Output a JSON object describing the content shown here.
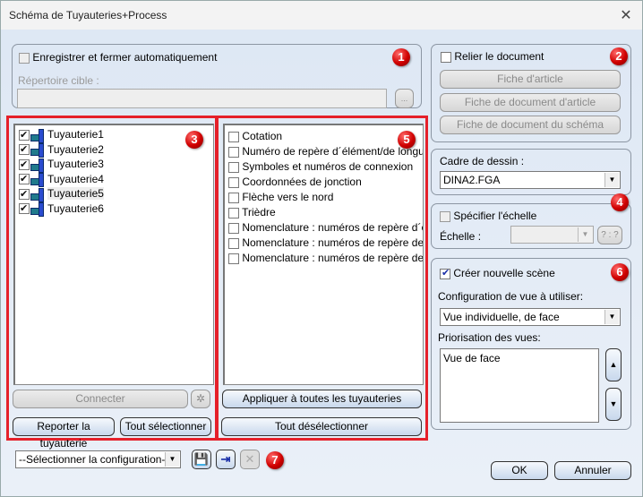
{
  "window": {
    "title": "Schéma de Tuyauteries+Process",
    "close_icon": "close-icon"
  },
  "group1": {
    "badge": "1",
    "auto_save_label": "Enregistrer et fermer automatiquement",
    "auto_save_checked": false,
    "target_dir_label": "Répertoire cible :",
    "target_dir_value": "",
    "browse_label": "..."
  },
  "pipes": {
    "badge": "3",
    "items": [
      {
        "label": "Tuyauterie1",
        "checked": true
      },
      {
        "label": "Tuyauterie2",
        "checked": true
      },
      {
        "label": "Tuyauterie3",
        "checked": true
      },
      {
        "label": "Tuyauterie4",
        "checked": true
      },
      {
        "label": "Tuyauterie5",
        "checked": true
      },
      {
        "label": "Tuyauterie6",
        "checked": true
      }
    ],
    "connect_label": "Connecter",
    "report_label": "Reporter la tuyauterie",
    "select_all_label": "Tout sélectionner"
  },
  "options": {
    "badge": "5",
    "items": [
      {
        "label": "Cotation",
        "checked": false
      },
      {
        "label": "Numéro de repère d´élément/de longueur",
        "checked": false
      },
      {
        "label": "Symboles et numéros de connexion",
        "checked": false
      },
      {
        "label": "Coordonnées de jonction",
        "checked": false
      },
      {
        "label": "Flèche vers le nord",
        "checked": false
      },
      {
        "label": "Trièdre",
        "checked": false
      },
      {
        "label": "Nomenclature : numéros de repère d´élé...",
        "checked": false
      },
      {
        "label": "Nomenclature : numéros de repère de r...",
        "checked": false
      },
      {
        "label": "Nomenclature : numéros de repère de c...",
        "checked": false
      }
    ],
    "apply_all_label": "Appliquer à toutes les tuyauteries",
    "deselect_all_label": "Tout désélectionner"
  },
  "group2": {
    "badge": "2",
    "link_doc_label": "Relier le document",
    "link_doc_checked": false,
    "article_sheet": "Fiche d'article",
    "article_doc_sheet": "Fiche de document d'article",
    "schema_doc_sheet": "Fiche de document du schéma"
  },
  "frame": {
    "label": "Cadre de dessin :",
    "value": "DINA2.FGA"
  },
  "scale": {
    "badge": "4",
    "specify_label": "Spécifier l'échelle",
    "specify_checked": false,
    "scale_label": "Échelle :",
    "scale_value": "",
    "ratio_button": "? : ?"
  },
  "scene": {
    "badge": "6",
    "create_label": "Créer nouvelle scène",
    "create_checked": true,
    "view_config_label": "Configuration de vue à utiliser:",
    "view_config_value": "Vue individuelle, de face",
    "priority_label": "Priorisation des vues:",
    "priority_items": [
      "Vue de face"
    ]
  },
  "config": {
    "badge": "7",
    "select_value": "--Sélectionner la configuration--"
  },
  "footer": {
    "ok_label": "OK",
    "cancel_label": "Annuler"
  }
}
